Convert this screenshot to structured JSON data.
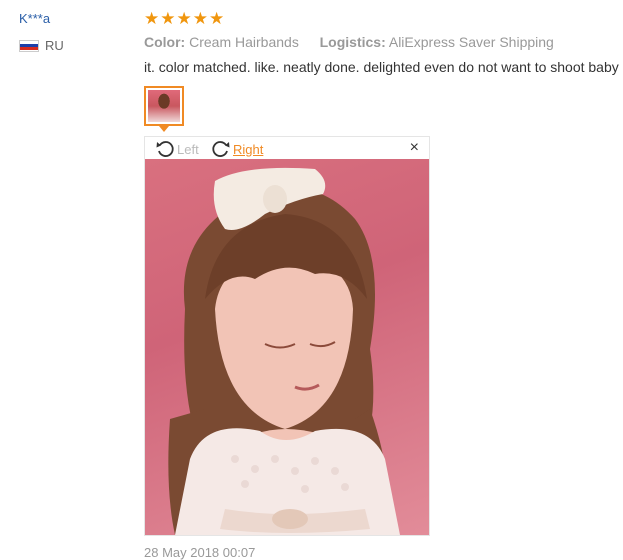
{
  "user": {
    "name": "K***a",
    "country_code": "RU",
    "flag_colors": [
      "#ffffff",
      "#1c3fa8",
      "#d52b1e"
    ]
  },
  "rating": {
    "stars": 5,
    "max": 5,
    "color": "#f0960e"
  },
  "meta": {
    "color_label": "Color:",
    "color_value": "Cream Hairbands",
    "logistics_label": "Logistics:",
    "logistics_value": "AliExpress Saver Shipping"
  },
  "review": {
    "text": "it. color matched. like. neatly done. delighted even do not want to shoot baby"
  },
  "viewer": {
    "rotate_left_label": "Left",
    "rotate_right_label": "Right",
    "close_glyph": "×",
    "accent_color": "#f08a24"
  },
  "date": "28 May 2018 00:07"
}
